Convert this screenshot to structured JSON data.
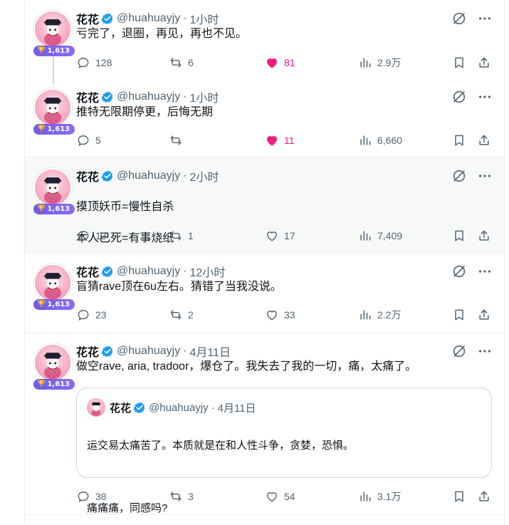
{
  "author": {
    "name": "花花",
    "handle": "@huahuayjy",
    "badge": "1,613"
  },
  "tweets": [
    {
      "time": "1小时",
      "lines": [
        "亏完了，退圈，再见，再也不见。"
      ],
      "replies": "128",
      "retweets": "6",
      "likes": "81",
      "views": "2.9万",
      "liked": true
    },
    {
      "time": "1小时",
      "lines": [
        "推特无限期停更，后悔无期"
      ],
      "replies": "5",
      "retweets": "",
      "likes": "11",
      "views": "6,660",
      "liked": true
    },
    {
      "time": "2小时",
      "lines": [
        "摸顶妖币=慢性自杀",
        "本人已死=有事烧纸"
      ],
      "replies": "13",
      "retweets": "1",
      "likes": "17",
      "views": "7,409",
      "liked": false
    },
    {
      "time": "12小时",
      "lines": [
        "盲猜rave顶在6u左右。猜错了当我没说。"
      ],
      "replies": "23",
      "retweets": "2",
      "likes": "33",
      "views": "2.2万",
      "liked": false
    },
    {
      "time": "4月11日",
      "lines": [
        "做空rave, aria, tradoor，爆仓了。我失去了我的一切，痛，太痛了。"
      ],
      "replies": "38",
      "retweets": "3",
      "likes": "54",
      "views": "3.1万",
      "liked": false,
      "quote": {
        "time": "4月11日",
        "line1": "运交易太痛苦了。本质就是在和人性斗争，贪婪，恐惧。",
        "line2": "痛痛痛，同感吗?"
      }
    }
  ],
  "colors": {
    "accent": "#1d9bf0",
    "like": "#f91880",
    "muted": "#536471",
    "badge": "#7a63ee"
  },
  "icons": [
    "verified-badge-icon",
    "grok-icon",
    "more-icon",
    "reply-icon",
    "retweet-icon",
    "heart-icon",
    "views-icon",
    "bookmark-icon",
    "share-icon",
    "trophy-icon"
  ]
}
